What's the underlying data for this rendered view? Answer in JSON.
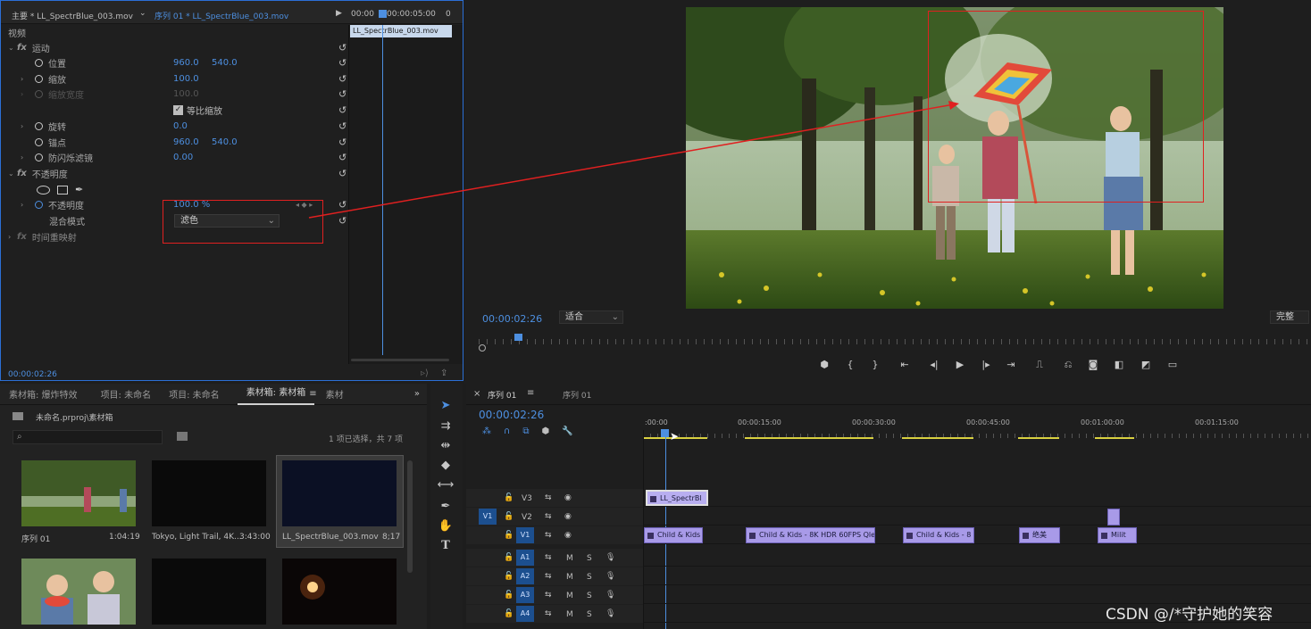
{
  "effect_controls": {
    "source_label": "主要 * LL_SpectrBlue_003.mov",
    "sequence_label": "序列 01 * LL_SpectrBlue_003.mov",
    "tl_time_start": "00:00",
    "tl_time_mid": "00:00:05:00",
    "tl_time_end": "0",
    "clip_name": "LL_SpectrBlue_003.mov",
    "video_header": "视频",
    "motion": "运动",
    "position": {
      "label": "位置",
      "x": "960.0",
      "y": "540.0"
    },
    "scale": {
      "label": "缩放",
      "value": "100.0"
    },
    "scale_width": {
      "label": "缩放宽度",
      "value": "100.0"
    },
    "uniform_scale": "等比缩放",
    "rotation": {
      "label": "旋转",
      "value": "0.0"
    },
    "anchor": {
      "label": "锚点",
      "x": "960.0",
      "y": "540.0"
    },
    "anti_flicker": {
      "label": "防闪烁滤镜",
      "value": "0.00"
    },
    "opacity_group": "不透明度",
    "opacity": {
      "label": "不透明度",
      "value": "100.0 %"
    },
    "blend_mode": {
      "label": "混合模式",
      "value": "滤色"
    },
    "time_remap": "时间重映射",
    "fx_glyph": "fx",
    "current_time": "00:00:02:26"
  },
  "program": {
    "timecode": "00:00:02:26",
    "fit": "适合",
    "quality": "完整"
  },
  "project": {
    "tabs": [
      "素材箱: 爆炸特效",
      "项目: 未命名",
      "项目: 未命名",
      "素材箱: 素材箱",
      "素材"
    ],
    "path": "未命名.prproj\\素材箱",
    "selection": "1 项已选择，共 7 项",
    "items": [
      {
        "name": "序列 01",
        "duration": "1:04:19"
      },
      {
        "name": "Tokyo, Light Trail, 4K...",
        "duration": "3:43:00"
      },
      {
        "name": "LL_SpectrBlue_003.mov",
        "duration": "8;17"
      }
    ]
  },
  "timeline": {
    "tabs": [
      "序列 01",
      "序列 01"
    ],
    "timecode": "00:00:02:26",
    "ruler": [
      ":00:00",
      "00:00:15:00",
      "00:00:30:00",
      "00:00:45:00",
      "00:01:00:00",
      "00:01:15:00"
    ],
    "tracks_video": [
      "V3",
      "V2",
      "V1"
    ],
    "tracks_audio": [
      "A1",
      "A2",
      "A3",
      "A4"
    ],
    "src_v": "V1",
    "mute": "M",
    "solo": "S",
    "clips_v3": [
      "LL_SpectrBl"
    ],
    "clips_v1": [
      "Child & Kids",
      "Child & Kids - 8K HDR 60FPS Qled",
      "Child & Kids - 8",
      "绝美",
      "Milit"
    ]
  },
  "watermark": "CSDN @/*守护她的笑容",
  "colors": {
    "accent": "#2b6fd6",
    "highlight": "#e02020",
    "clip": "#a89ae8",
    "playhead": "#4d8fe0"
  }
}
